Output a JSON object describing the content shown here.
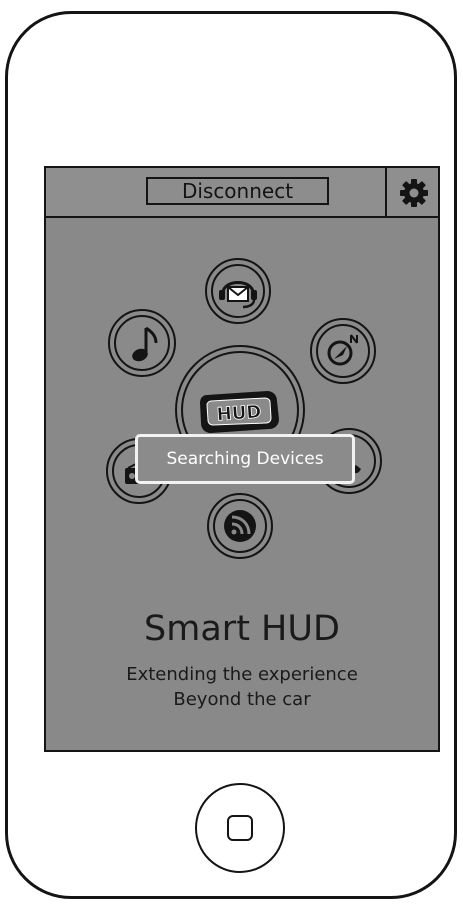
{
  "toolbar": {
    "disconnect_label": "Disconnect",
    "settings_icon": "gear-icon"
  },
  "features": [
    {
      "name": "messages",
      "icon": "headset-mail-icon"
    },
    {
      "name": "music",
      "icon": "music-note-icon"
    },
    {
      "name": "navigation",
      "icon": "compass-icon"
    },
    {
      "name": "hud",
      "icon": "hud-display-icon"
    },
    {
      "name": "radio",
      "icon": "radio-icon"
    },
    {
      "name": "phone",
      "icon": "phone-icon"
    },
    {
      "name": "feed",
      "icon": "rss-feed-icon"
    }
  ],
  "toast": {
    "text": "Searching Devices"
  },
  "branding": {
    "title": "Smart HUD",
    "subtitle_line1": "Extending the experience",
    "subtitle_line2": "Beyond the car",
    "hud_label": "HUD"
  },
  "colors": {
    "screen_bg": "#898989",
    "outline": "#141414",
    "toast_border": "#f2f2f2",
    "toast_text": "#ffffff"
  }
}
